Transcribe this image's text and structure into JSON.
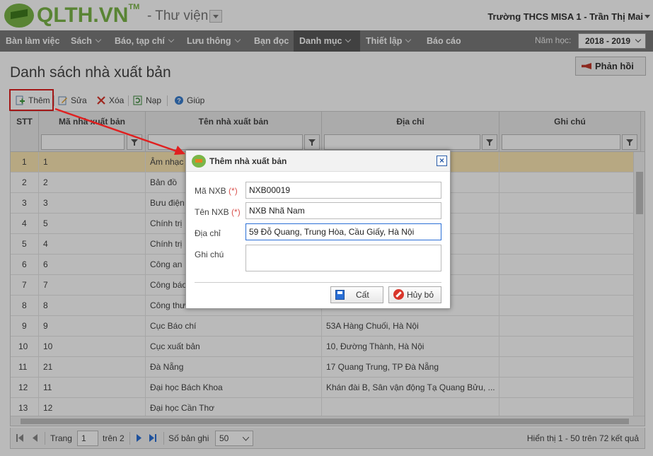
{
  "header": {
    "logo_text": "QLTH.VN",
    "logo_tm": "TM",
    "library_title": "- Thư viện",
    "user_info": "Trường THCS MISA 1 - Trần Thị Mai"
  },
  "nav": {
    "items": [
      "Bàn làm việc",
      "Sách",
      "Báo, tạp chí",
      "Lưu thông",
      "Bạn đọc",
      "Danh mục",
      "Thiết lập",
      "Báo cáo"
    ],
    "active": "Danh mục",
    "year_label": "Năm học:",
    "year_value": "2018 - 2019"
  },
  "page": {
    "title": "Danh sách nhà xuất bản",
    "feedback_label": "Phản hồi"
  },
  "toolbar": {
    "add": "Thêm",
    "edit": "Sửa",
    "delete": "Xóa",
    "reload": "Nạp",
    "help": "Giúp"
  },
  "grid": {
    "columns": [
      "STT",
      "Mã nhà xuất bản",
      "Tên nhà xuất bản",
      "Địa chỉ",
      "Ghi chú"
    ],
    "rows": [
      {
        "stt": "1",
        "code": "1",
        "name": "Âm nhạc",
        "address": ""
      },
      {
        "stt": "2",
        "code": "2",
        "name": "Bản đồ",
        "address": ""
      },
      {
        "stt": "3",
        "code": "3",
        "name": "Bưu điện",
        "address": ""
      },
      {
        "stt": "4",
        "code": "5",
        "name": "Chính trị",
        "address": ""
      },
      {
        "stt": "5",
        "code": "4",
        "name": "Chính trị",
        "address": ""
      },
      {
        "stt": "6",
        "code": "6",
        "name": "Công an",
        "address": ""
      },
      {
        "stt": "7",
        "code": "7",
        "name": "Công báo",
        "address": ""
      },
      {
        "stt": "8",
        "code": "8",
        "name": "Công thư",
        "address": ""
      },
      {
        "stt": "9",
        "code": "9",
        "name": "Cục Báo chí",
        "address": "53A Hàng Chuối, Hà Nội"
      },
      {
        "stt": "10",
        "code": "10",
        "name": "Cục xuất bản",
        "address": "10, Đường Thành, Hà Nội"
      },
      {
        "stt": "11",
        "code": "21",
        "name": "Đà Nẵng",
        "address": "17 Quang Trung, TP Đà Nẵng"
      },
      {
        "stt": "12",
        "code": "11",
        "name": "Đại học Bách Khoa",
        "address": "Khán đài B, Sân vận động Tạ Quang Bửu, ..."
      },
      {
        "stt": "13",
        "code": "12",
        "name": "Đại học Cần Thơ",
        "address": ""
      }
    ],
    "selected_row": 0
  },
  "pager": {
    "page_label": "Trang",
    "page_value": "1",
    "of_label": "trên 2",
    "records_label": "Số bản ghi",
    "records_value": "50",
    "summary": "Hiển thị 1 - 50 trên 72 kết quả"
  },
  "dialog": {
    "title": "Thêm nhà xuất bản",
    "code_label": "Mã NXB",
    "name_label": "Tên NXB",
    "address_label": "Địa chỉ",
    "note_label": "Ghi chú",
    "required_mark": "(*)",
    "code_value": "NXB00019",
    "name_value": "NXB Nhã Nam",
    "address_value": "59 Đỗ Quang, Trung Hòa, Cầu Giấy, Hà Nội",
    "note_value": "",
    "save_label": "Cất",
    "cancel_label": "Hủy bỏ"
  },
  "colors": {
    "brand_green": "#7ab648",
    "nav_bg": "#7a7a7a",
    "selected_row": "#fbe7b2",
    "annotation_red": "#e02020"
  }
}
